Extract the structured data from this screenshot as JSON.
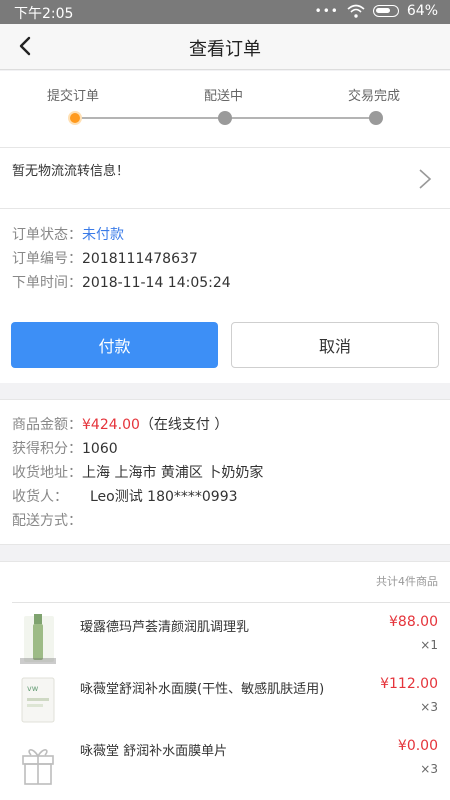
{
  "status": {
    "time": "下午2:05",
    "battery": "64%"
  },
  "nav": {
    "title": "查看订单"
  },
  "progress": {
    "steps": [
      "提交订单",
      "配送中",
      "交易完成"
    ],
    "current_step": 1
  },
  "logistics": {
    "text": "暂无物流流转信息！"
  },
  "order": {
    "status_label": "订单状态：",
    "status_value": "未付款",
    "number_label": "订单编号：",
    "number_value": "2018111478637",
    "time_label": "下单时间：",
    "time_value": "2018-11-14 14:05:24"
  },
  "actions": {
    "pay": "付款",
    "cancel": "取消"
  },
  "amounts": {
    "total_label": "商品金额：",
    "total_value": "¥424.00",
    "pay_method": "（在线支付 ）",
    "points_label": "获得积分：",
    "points_value": "1060",
    "address_label": "收货地址：",
    "address_value": "上海 上海市 黄浦区 卜奶奶家",
    "receiver_label": "收货人：",
    "receiver_value": "Leo测试  180****0993",
    "delivery_label": "配送方式：",
    "delivery_value": ""
  },
  "goods": {
    "summary": "共计4件商品",
    "items": [
      {
        "name": "瑷露德玛芦荟清颜润肌调理乳",
        "price": "¥88.00",
        "qty": "×1",
        "icon": "lotion-bottle-image"
      },
      {
        "name": "咏薇堂舒润补水面膜(干性、敏感肌肤适用)",
        "price": "¥112.00",
        "qty": "×3",
        "icon": "mask-box-image"
      },
      {
        "name": "咏薇堂 舒润补水面膜单片",
        "price": "¥0.00",
        "qty": "×3",
        "icon": "gift-icon"
      }
    ]
  },
  "colors": {
    "accent_blue": "#3d8ff6",
    "link_blue": "#3a7be8",
    "price_red": "#e5343b",
    "progress_orange": "#ff9a1e"
  }
}
